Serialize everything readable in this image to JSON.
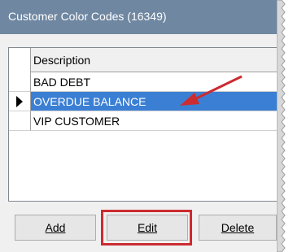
{
  "window": {
    "title": "Customer Color Codes (16349)"
  },
  "grid": {
    "header": "Description",
    "rows": [
      {
        "label": "BAD DEBT",
        "selected": false
      },
      {
        "label": "OVERDUE BALANCE",
        "selected": true
      },
      {
        "label": "VIP CUSTOMER",
        "selected": false
      }
    ]
  },
  "buttons": {
    "add": "Add",
    "edit": "Edit",
    "delete": "Delete"
  },
  "colors": {
    "title_bar": "#6f87a1",
    "selection": "#3b7fd4",
    "annotation": "#cc2b30"
  }
}
